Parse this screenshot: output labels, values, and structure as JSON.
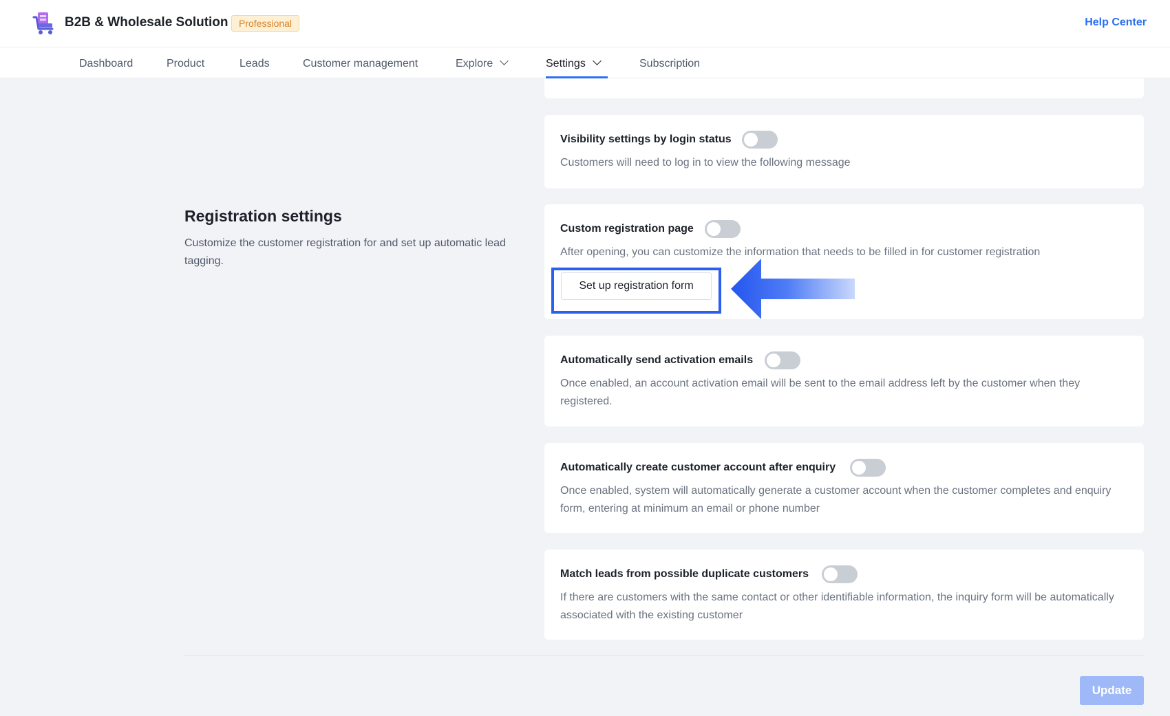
{
  "header": {
    "app_title": "B2B & Wholesale Solution",
    "plan_badge": "Professional",
    "help_link": "Help Center",
    "logo_icon": "wholesale-cart-logo"
  },
  "nav": {
    "items": [
      {
        "label": "Dashboard"
      },
      {
        "label": "Product"
      },
      {
        "label": "Leads"
      },
      {
        "label": "Customer management"
      },
      {
        "label": "Explore",
        "dropdown": true
      },
      {
        "label": "Settings",
        "dropdown": true,
        "active": true
      },
      {
        "label": "Subscription"
      }
    ],
    "accent_color": "#2b6ff2"
  },
  "visibility_card": {
    "title": "Visibility settings by login status",
    "description": "Customers will need to log in to view the following message",
    "enabled": false
  },
  "registration_section": {
    "title": "Registration settings",
    "description": "Customize the customer registration for and set up automatic lead tagging."
  },
  "custom_registration_card": {
    "title": "Custom registration page",
    "description": "After opening, you can customize the information that needs to be filled in for customer registration",
    "enabled": false,
    "button_label": "Set up registration form"
  },
  "activation_email_card": {
    "title": "Automatically send activation emails",
    "description": "Once enabled, an account activation email will be sent to the email address left by the customer when they registered.",
    "enabled": false
  },
  "auto_account_card": {
    "title": "Automatically create customer account after enquiry",
    "description": "Once enabled, system will automatically generate a customer account when the customer completes and enquiry form, entering at minimum an email or phone number",
    "enabled": false
  },
  "duplicate_match_card": {
    "title": "Match leads from possible duplicate customers",
    "description": "If there are customers with the same contact or other identifiable information, the inquiry form will be automatically associated with the existing customer",
    "enabled": false
  },
  "footer": {
    "update_label": "Update"
  },
  "annotation": {
    "highlight_color": "#2b5ff0",
    "arrow_icon": "left-arrow-icon"
  }
}
